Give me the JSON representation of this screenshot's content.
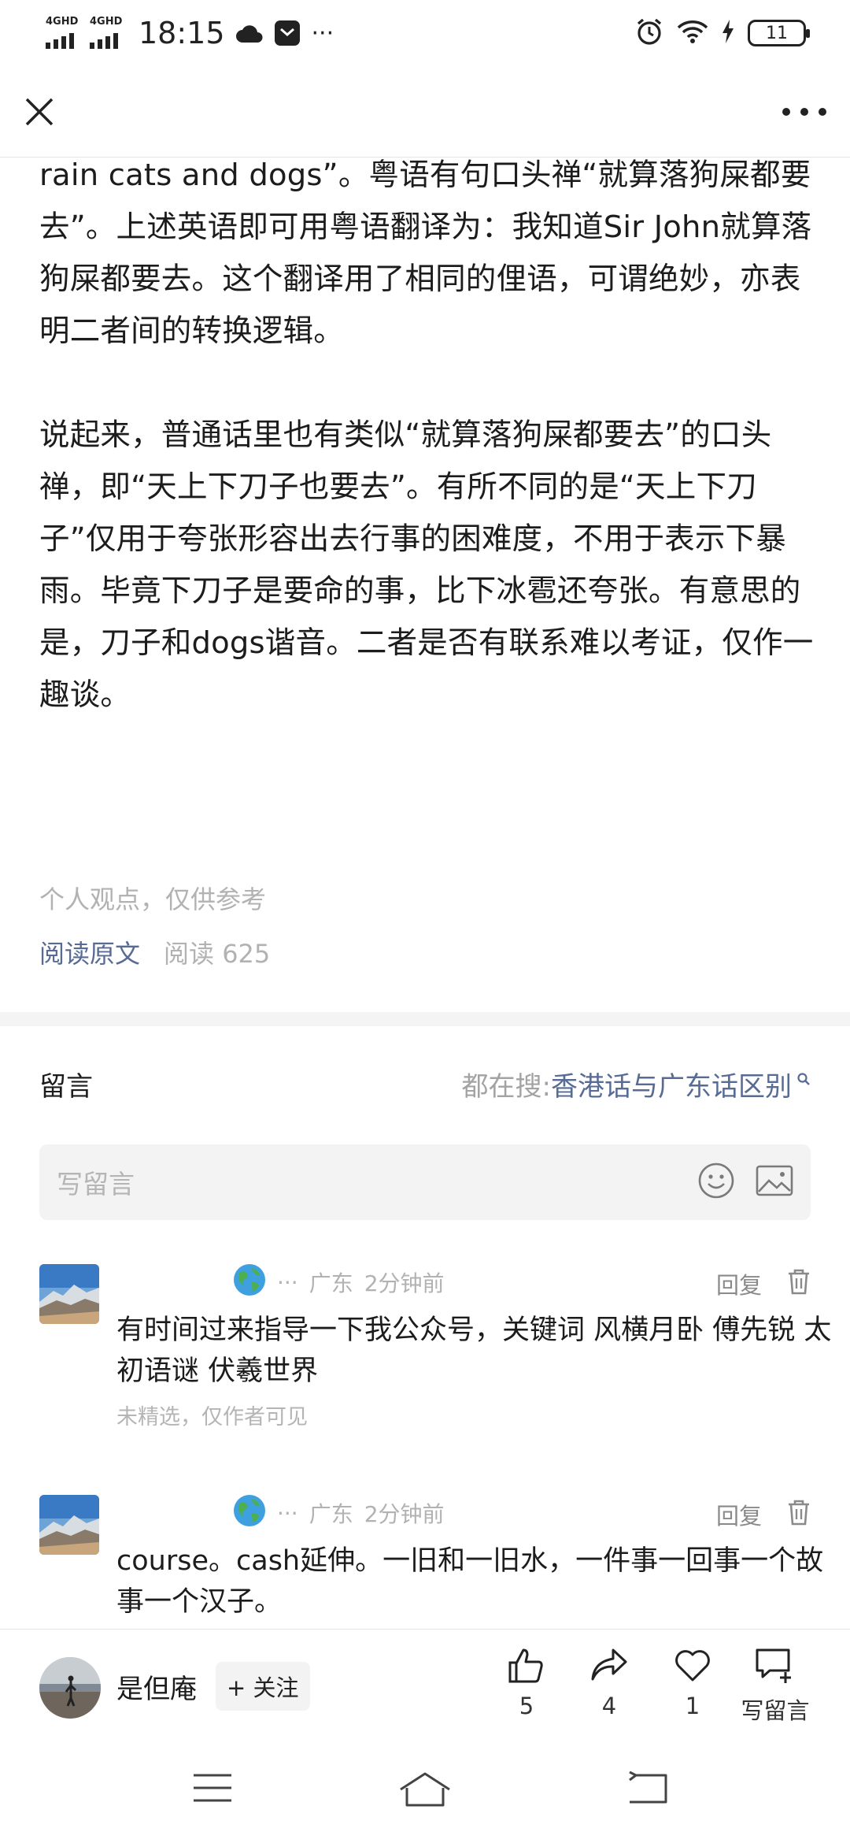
{
  "status_bar": {
    "network_1": "4GHD",
    "network_2": "4GHD",
    "time": "18:15",
    "more": "···",
    "battery": "11"
  },
  "article": {
    "paragraphs": [
      "rain cats and dogs”。粤语有句口头禅“就算落狗屎都要去”。上述英语即可用粤语翻译为：我知道Sir John就算落狗屎都要去。这个翻译用了相同的俚语，可谓绝妙，亦表明二者间的转换逻辑。",
      "说起来，普通话里也有类似“就算落狗屎都要去”的口头禅，即“天上下刀子也要去”。有所不同的是“天上下刀子”仅用于夸张形容出去行事的困难度，不用于表示下暴雨。毕竟下刀子是要命的事，比下冰雹还夸张。有意思的是，刀子和dogs谐音。二者是否有联系难以考证，仅作一趣谈。"
    ],
    "note": "个人观点，仅供参考",
    "read_original": "阅读原文",
    "read_count": "阅读 625"
  },
  "comments": {
    "title": "留言",
    "search_prefix": "都在搜: ",
    "search_term": "香港话与广东话区别",
    "write_placeholder": "写留言",
    "items": [
      {
        "dots": "···",
        "location": "广东",
        "time": "2分钟前",
        "reply": "回复",
        "text": "有时间过来指导一下我公众号，关键词 风横月卧 傅先锐 太初语谜 伏羲世界",
        "sub": "未精选，仅作者可见"
      },
      {
        "dots": "···",
        "location": "广东",
        "time": "2分钟前",
        "reply": "回复",
        "text": "course。cash延伸。一旧和一旧水，一件事一回事一个故事一个汉子。"
      }
    ]
  },
  "action_bar": {
    "author": "是但庵",
    "follow": "+ 关注",
    "like_count": "5",
    "share_count": "4",
    "heart_count": "1",
    "write_label": "写留言"
  }
}
